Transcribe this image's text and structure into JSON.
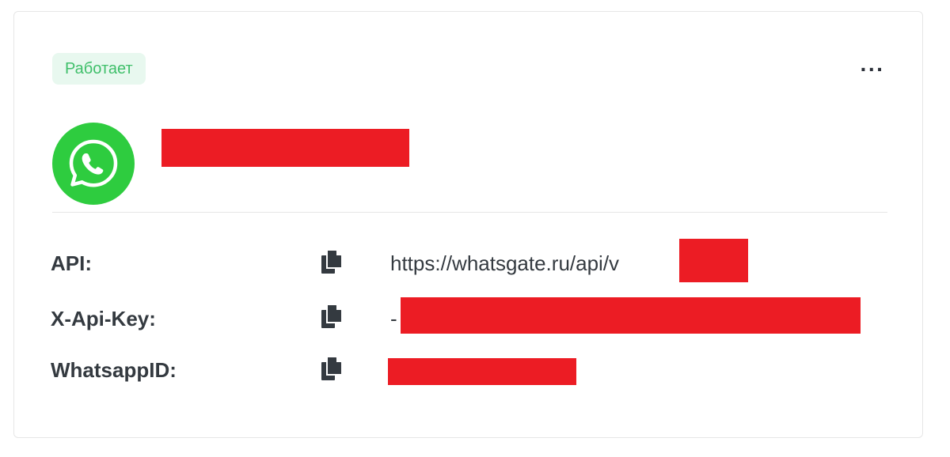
{
  "status": {
    "label": "Работает",
    "color": "#3fbf6a"
  },
  "menu": {
    "more_label": "···"
  },
  "channel": {
    "icon": "whatsapp-icon",
    "brand_color": "#2ecc3f"
  },
  "details": [
    {
      "label": "API:",
      "value": "https://whatsgate.ru/api/v",
      "copy_icon": "copy-icon"
    },
    {
      "label": "X-Api-Key:",
      "value": "-",
      "copy_icon": "copy-icon"
    },
    {
      "label": "WhatsappID:",
      "value": "",
      "copy_icon": "copy-icon"
    }
  ],
  "redaction_color": "#ec1c24"
}
